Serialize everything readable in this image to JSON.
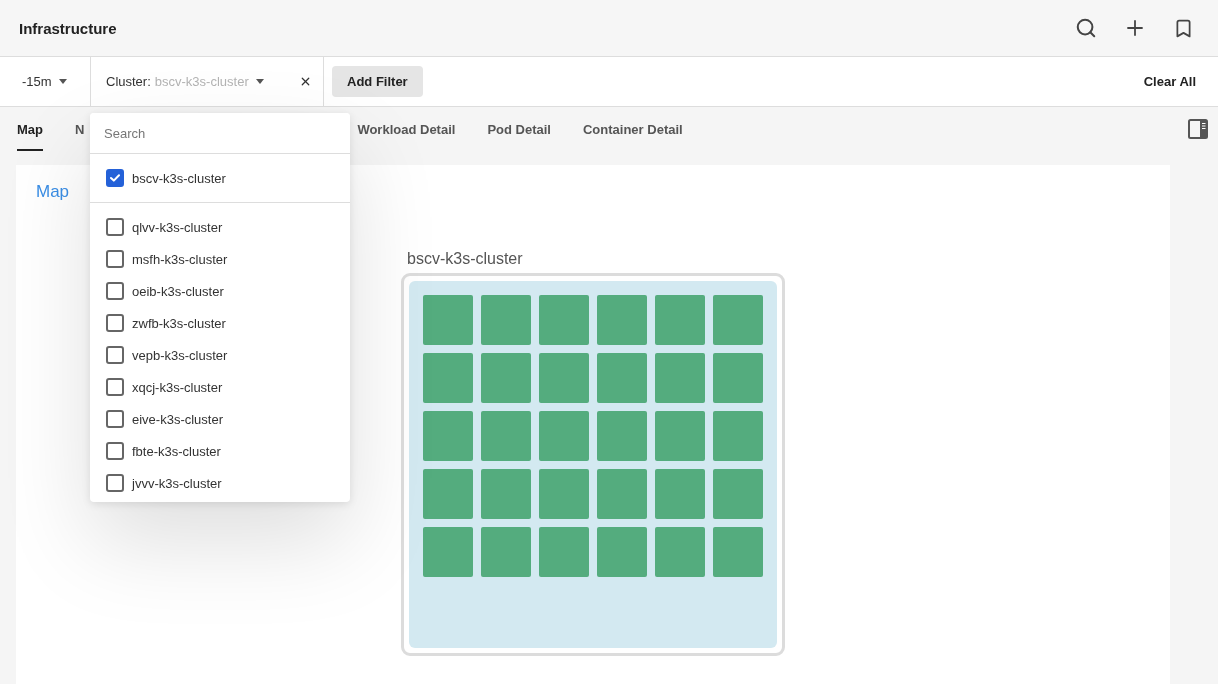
{
  "header": {
    "title": "Infrastructure"
  },
  "filter_bar": {
    "time_range": "-15m",
    "filters": [
      {
        "label": "Cluster:",
        "value": "bscv-k3s-cluster"
      }
    ],
    "add_filter": "Add Filter",
    "clear_all": "Clear All"
  },
  "tabs": [
    {
      "label": "Map",
      "selected": true
    },
    {
      "label": "N",
      "selected": false
    },
    {
      "label": "Workload Detail",
      "selected": false
    },
    {
      "label": "Pod Detail",
      "selected": false
    },
    {
      "label": "Container Detail",
      "selected": false
    }
  ],
  "cluster_menu": {
    "search": {
      "placeholder": "Search"
    },
    "selected_options": [
      {
        "label": "bscv-k3s-cluster",
        "checked": true
      }
    ],
    "options": [
      {
        "label": "qlvv-k3s-cluster",
        "checked": false
      },
      {
        "label": "msfh-k3s-cluster",
        "checked": false
      },
      {
        "label": "oeib-k3s-cluster",
        "checked": false
      },
      {
        "label": "zwfb-k3s-cluster",
        "checked": false
      },
      {
        "label": "vepb-k3s-cluster",
        "checked": false
      },
      {
        "label": "xqcj-k3s-cluster",
        "checked": false
      },
      {
        "label": "eive-k3s-cluster",
        "checked": false
      },
      {
        "label": "fbte-k3s-cluster",
        "checked": false
      },
      {
        "label": "jvvv-k3s-cluster",
        "checked": false
      }
    ]
  },
  "map": {
    "title": "Map",
    "clusters": [
      {
        "name": "bscv-k3s-cluster",
        "pods": [
          {
            "color": "#54ac7e"
          },
          {
            "color": "#54ac7e"
          },
          {
            "color": "#54ac7e"
          },
          {
            "color": "#54ac7e"
          },
          {
            "color": "#54ac7e"
          },
          {
            "color": "#54ac7e"
          },
          {
            "color": "#54ac7e"
          },
          {
            "color": "#54ac7e"
          },
          {
            "color": "#54ac7e"
          },
          {
            "color": "#54ac7e"
          },
          {
            "color": "#54ac7e"
          },
          {
            "color": "#54ac7e"
          },
          {
            "color": "#54ac7e"
          },
          {
            "color": "#54ac7e"
          },
          {
            "color": "#54ac7e"
          },
          {
            "color": "#54ac7e"
          },
          {
            "color": "#54ac7e"
          },
          {
            "color": "#54ac7e"
          },
          {
            "color": "#54ac7e"
          },
          {
            "color": "#54ac7e"
          },
          {
            "color": "#54ac7e"
          },
          {
            "color": "#54ac7e"
          },
          {
            "color": "#54ac7e"
          },
          {
            "color": "#54ac7e"
          },
          {
            "color": "#54ac7e"
          },
          {
            "color": "#54ac7e"
          },
          {
            "color": "#54ac7e"
          },
          {
            "color": "#54ac7e"
          },
          {
            "color": "#54ac7e"
          },
          {
            "color": "#54ac7e"
          }
        ]
      }
    ]
  }
}
